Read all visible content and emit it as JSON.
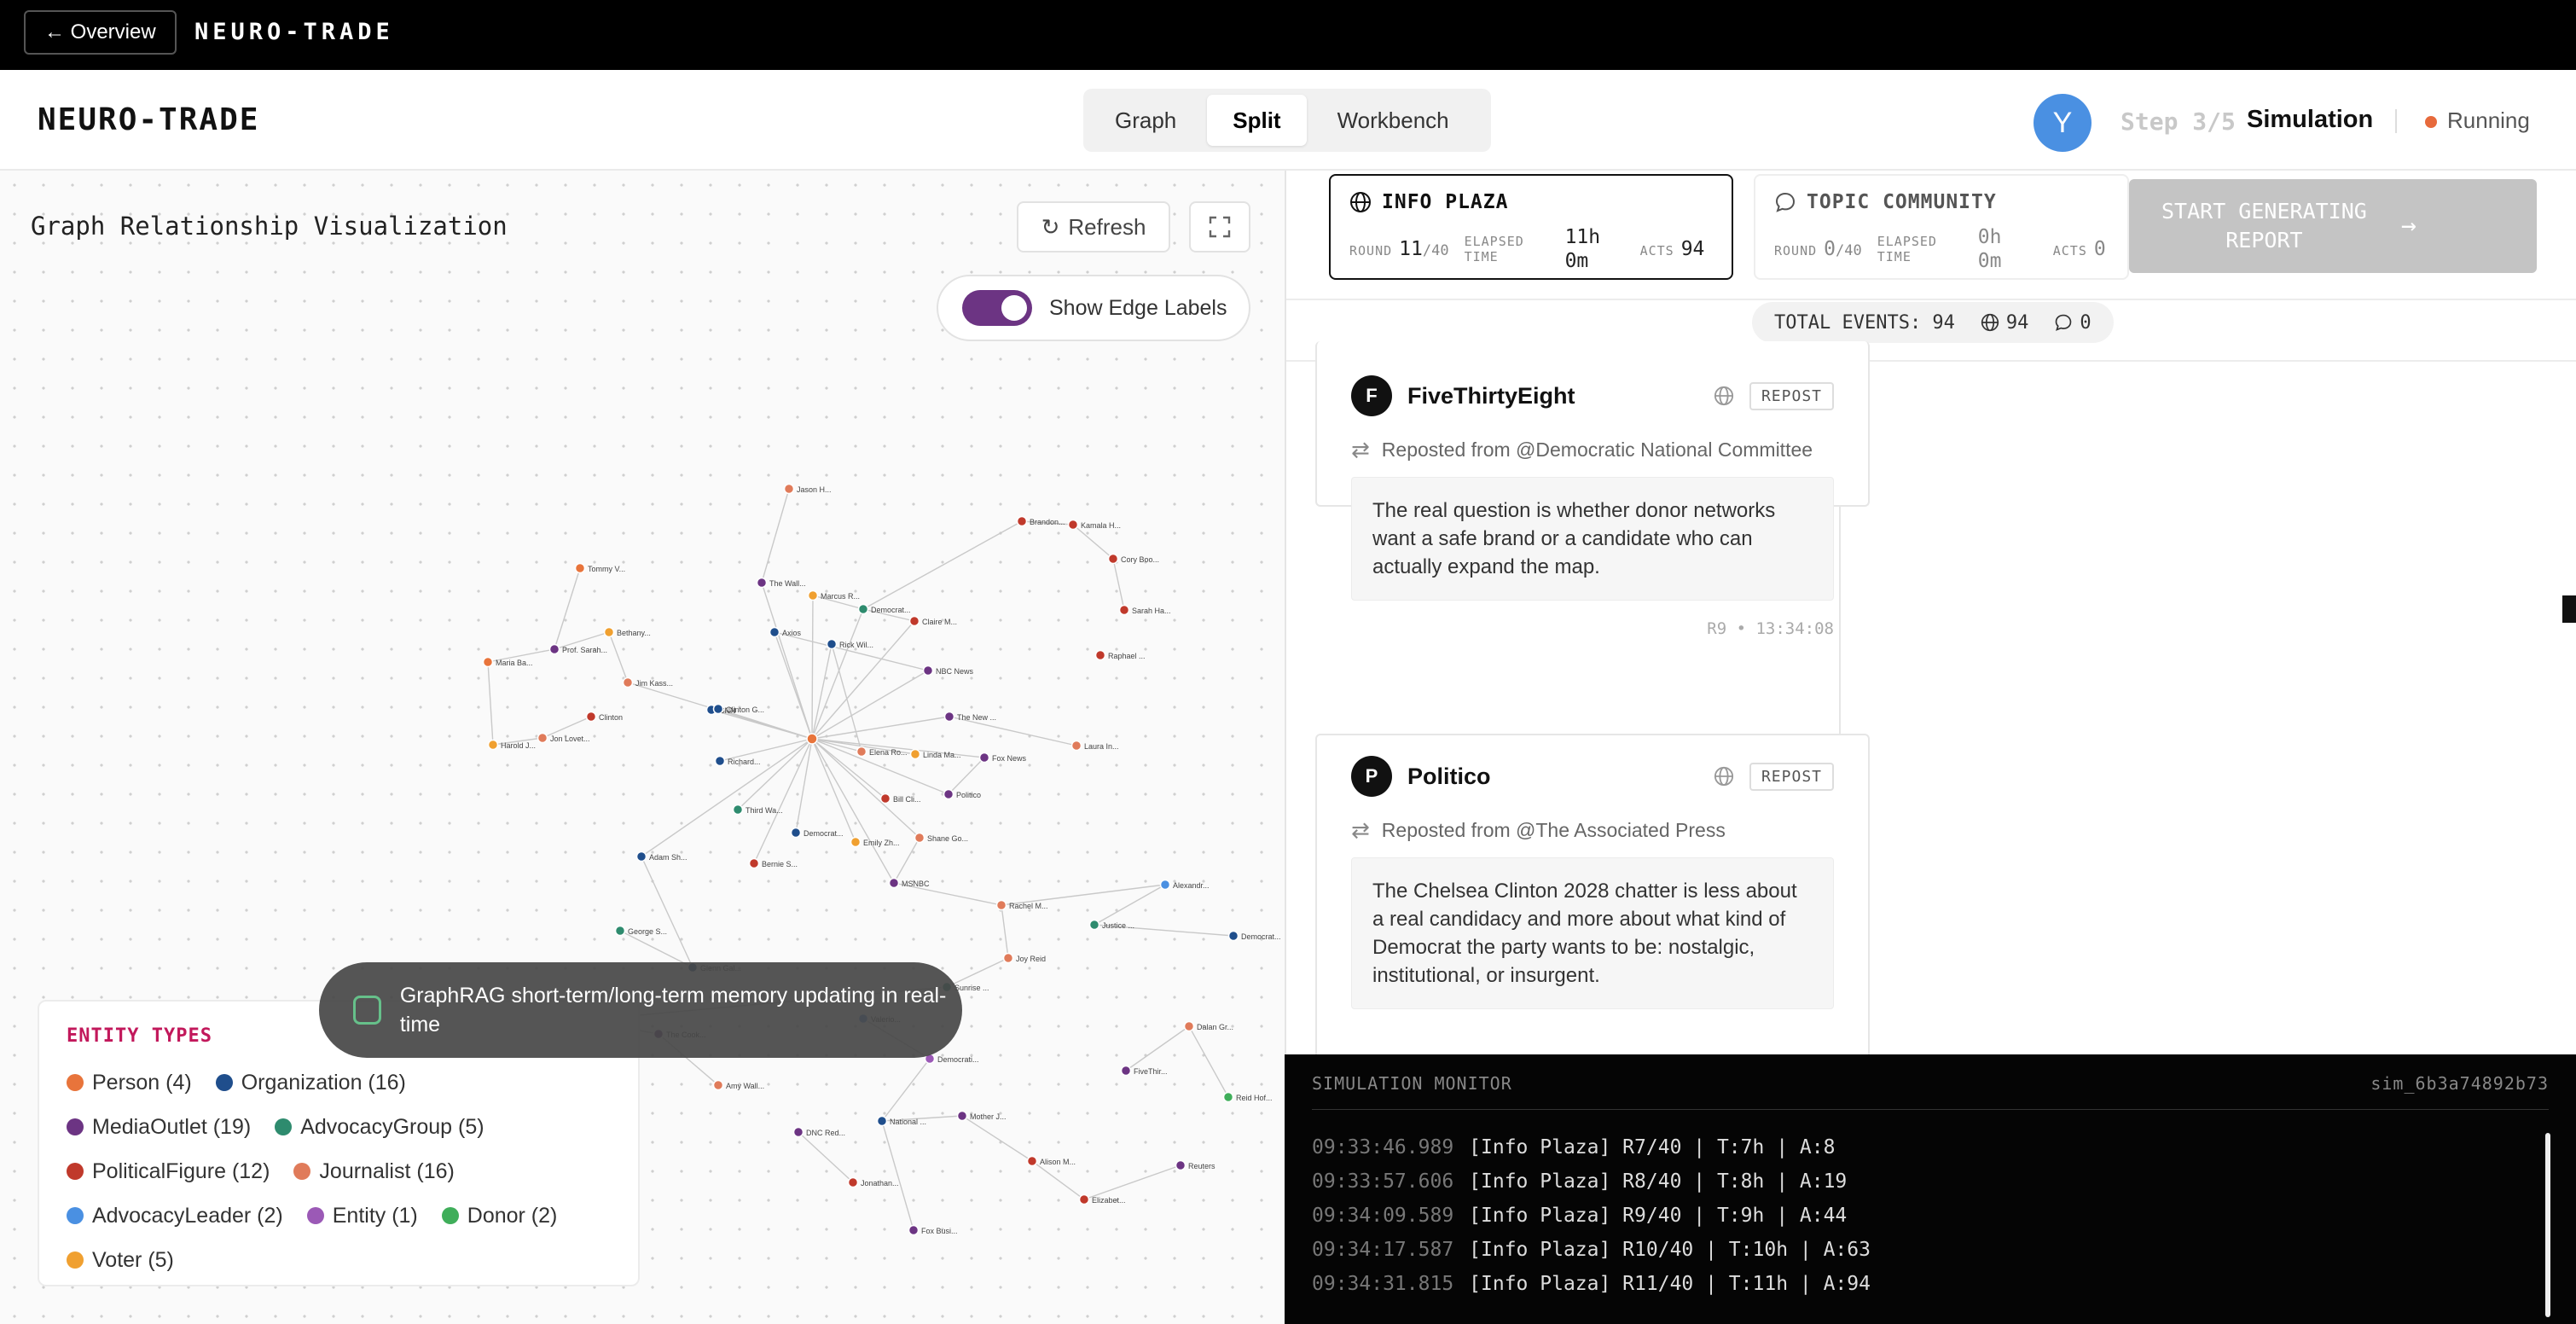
{
  "topbar": {
    "back_label": "← Overview",
    "brand": "NEURO-TRADE"
  },
  "header": {
    "brand": "NEURO-TRADE",
    "tabs": [
      {
        "label": "Graph"
      },
      {
        "label": "Split"
      },
      {
        "label": "Workbench"
      }
    ],
    "active_tab": "Split",
    "avatar_initial": "Y",
    "step": "Step 3/5",
    "step_name": "Simulation",
    "status": "Running",
    "status_color": "#e76a3c"
  },
  "graph": {
    "title": "Graph Relationship Visualization",
    "refresh_label": "Refresh",
    "edge_labels_toggle": "Show Edge Labels",
    "edge_labels_on": true,
    "toast": "GraphRAG short-term/long-term memory updating in real-time",
    "legend": {
      "title": "ENTITY TYPES",
      "items": [
        {
          "label": "Person (4)",
          "color": "#e8743b"
        },
        {
          "label": "Organization (16)",
          "color": "#1f4e8c"
        },
        {
          "label": "MediaOutlet (19)",
          "color": "#6c3483"
        },
        {
          "label": "AdvocacyGroup (5)",
          "color": "#2e8b6e"
        },
        {
          "label": "PoliticalFigure (12)",
          "color": "#c0392b"
        },
        {
          "label": "Journalist (16)",
          "color": "#e07b5a"
        },
        {
          "label": "AdvocacyLeader (2)",
          "color": "#4a90e2"
        },
        {
          "label": "Entity (1)",
          "color": "#9b59b6"
        },
        {
          "label": "Donor (2)",
          "color": "#3fae5a"
        },
        {
          "label": "Voter (5)",
          "color": "#f0a030"
        }
      ]
    },
    "nodes": [
      {
        "label": "Jason H...",
        "type": 5
      },
      {
        "label": "Tommy V...",
        "type": 0
      },
      {
        "label": "Brandon...",
        "type": 4
      },
      {
        "label": "Kamala H...",
        "type": 4
      },
      {
        "label": "Cory Boo...",
        "type": 4
      },
      {
        "label": "Sarah Ha...",
        "type": 4
      },
      {
        "label": "Raphael ...",
        "type": 4
      },
      {
        "label": "Laura In...",
        "type": 5
      },
      {
        "label": "Marcus R...",
        "type": 9
      },
      {
        "label": "Democrat...",
        "type": 3
      },
      {
        "label": "Claire M...",
        "type": 4
      },
      {
        "label": "Bethany...",
        "type": 9
      },
      {
        "label": "Prof. Sarah...",
        "type": 2
      },
      {
        "label": "Maria Ba...",
        "type": 0
      },
      {
        "label": "Jim Kass...",
        "type": 5
      },
      {
        "label": "Clinton",
        "type": 4
      },
      {
        "label": "Harold J...",
        "type": 9
      },
      {
        "label": "Jon Lovet...",
        "type": 5
      },
      {
        "label": "The Wall...",
        "type": 2
      },
      {
        "label": "Politico",
        "type": 2
      },
      {
        "label": "NBC News",
        "type": 2
      },
      {
        "label": "Axios",
        "type": 1
      },
      {
        "label": "The New ...",
        "type": 2
      },
      {
        "label": "Fox News",
        "type": 2
      },
      {
        "label": "Linda Ma...",
        "type": 9
      },
      {
        "label": "CNN",
        "type": 1
      },
      {
        "label": "Rick Wil...",
        "type": 1
      },
      {
        "label": "Elena Ro...",
        "type": 5
      },
      {
        "label": "Bill Cli...",
        "type": 4
      },
      {
        "label": "Shane Go...",
        "type": 5
      },
      {
        "label": "Emily Zh...",
        "type": 9
      },
      {
        "label": "Bernie S...",
        "type": 4
      },
      {
        "label": "Third Wa...",
        "type": 3
      },
      {
        "label": "Democrat...",
        "type": 1
      },
      {
        "label": "MSNBC",
        "type": 2
      },
      {
        "label": "Rachel M...",
        "type": 5
      },
      {
        "label": "Alexandr...",
        "type": 6
      },
      {
        "label": "Justice ...",
        "type": 3
      },
      {
        "label": "Democrat...",
        "type": 1
      },
      {
        "label": "Joy Reid",
        "type": 5
      },
      {
        "label": "Sunrise ...",
        "type": 3
      },
      {
        "label": "Jessica ...",
        "type": 5
      },
      {
        "label": "The Cook...",
        "type": 2
      },
      {
        "label": "Amy Wall...",
        "type": 5
      },
      {
        "label": "Valerio...",
        "type": 6
      },
      {
        "label": "Democrati...",
        "type": 7
      },
      {
        "label": "Dalan Gr...",
        "type": 5
      },
      {
        "label": "FiveThir...",
        "type": 2
      },
      {
        "label": "Reid Hof...",
        "type": 8
      },
      {
        "label": "Reuters",
        "type": 2
      },
      {
        "label": "Mother J...",
        "type": 2
      },
      {
        "label": "National ...",
        "type": 1
      },
      {
        "label": "Alison M...",
        "type": 4
      },
      {
        "label": "Elizabet...",
        "type": 4
      },
      {
        "label": "Fox Busi...",
        "type": 2
      },
      {
        "label": "George S...",
        "type": 3
      },
      {
        "label": "Glenn Gal...",
        "type": 1
      },
      {
        "label": "Adam Sh...",
        "type": 1
      },
      {
        "label": "Clinton G...",
        "type": 1
      },
      {
        "label": "Richard...",
        "type": 1
      },
      {
        "label": "Jonathan...",
        "type": 4
      },
      {
        "label": "DNC Red...",
        "type": 2
      }
    ]
  },
  "sim": {
    "envs": [
      {
        "name": "INFO PLAZA",
        "active": true,
        "icon": "globe-icon",
        "round_label": "ROUND",
        "round": "11",
        "round_total": "/40",
        "elapsed_label_1": "ELAPSED",
        "elapsed_label_2": "TIME",
        "elapsed_1": "11h",
        "elapsed_2": "0m",
        "acts_label": "ACTS",
        "acts": "94"
      },
      {
        "name": "TOPIC COMMUNITY",
        "active": false,
        "icon": "chat-bubble-icon",
        "round_label": "ROUND",
        "round": "0",
        "round_total": "/40",
        "elapsed_label_1": "ELAPSED",
        "elapsed_label_2": "TIME",
        "elapsed_1": "0h",
        "elapsed_2": "0m",
        "acts_label": "ACTS",
        "acts": "0"
      }
    ],
    "generate_line_1": "START GENERATING",
    "generate_line_2": "REPORT",
    "total_events_label": "TOTAL EVENTS: 94",
    "total_globe": "94",
    "total_chat": "0",
    "posts": [
      {
        "avatar": "F",
        "name": "FiveThirtyEight",
        "tag": "REPOST",
        "repost_from": "Reposted from @Democratic National Committee",
        "text": "The real question is whether donor networks want a safe brand or a candidate who can actually expand the map.",
        "meta": "R9 • 13:34:08"
      },
      {
        "avatar": "P",
        "name": "Politico",
        "tag": "REPOST",
        "repost_from": "Reposted from @The Associated Press",
        "text": "The Chelsea Clinton 2028 chatter is less about a real candidacy and more about what kind of Democrat the party wants to be: nostalgic, institutional, or insurgent.",
        "meta": ""
      }
    ]
  },
  "monitor": {
    "title": "SIMULATION MONITOR",
    "sim_id": "sim_6b3a74892b73",
    "lines": [
      {
        "ts": "09:33:46.989",
        "text": "[Info Plaza] R7/40 | T:7h | A:8"
      },
      {
        "ts": "09:33:57.606",
        "text": "[Info Plaza] R8/40 | T:8h | A:19"
      },
      {
        "ts": "09:34:09.589",
        "text": "[Info Plaza] R9/40 | T:9h | A:44"
      },
      {
        "ts": "09:34:17.587",
        "text": "[Info Plaza] R10/40 | T:10h | A:63"
      },
      {
        "ts": "09:34:31.815",
        "text": "[Info Plaza] R11/40 | T:11h | A:94"
      }
    ]
  }
}
